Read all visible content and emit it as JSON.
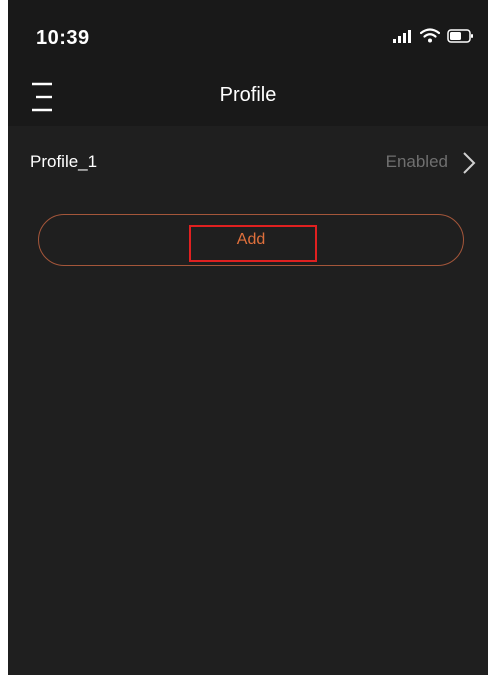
{
  "status_bar": {
    "time": "10:39",
    "icons": [
      "cellular-signal-icon",
      "wifi-icon",
      "battery-icon"
    ]
  },
  "nav": {
    "title": "Profile",
    "menu_icon": "menu-icon"
  },
  "profiles": [
    {
      "name": "Profile_1",
      "status": "Enabled",
      "chevron_icon": "chevron-right-icon"
    }
  ],
  "add_button": {
    "label": "Add"
  },
  "colors": {
    "background": "#1f1f1f",
    "bar_background": "#191919",
    "accent": "#e0703c",
    "button_border": "#a4563a",
    "highlight": "#e02020",
    "muted_text": "#6f6f6f"
  }
}
